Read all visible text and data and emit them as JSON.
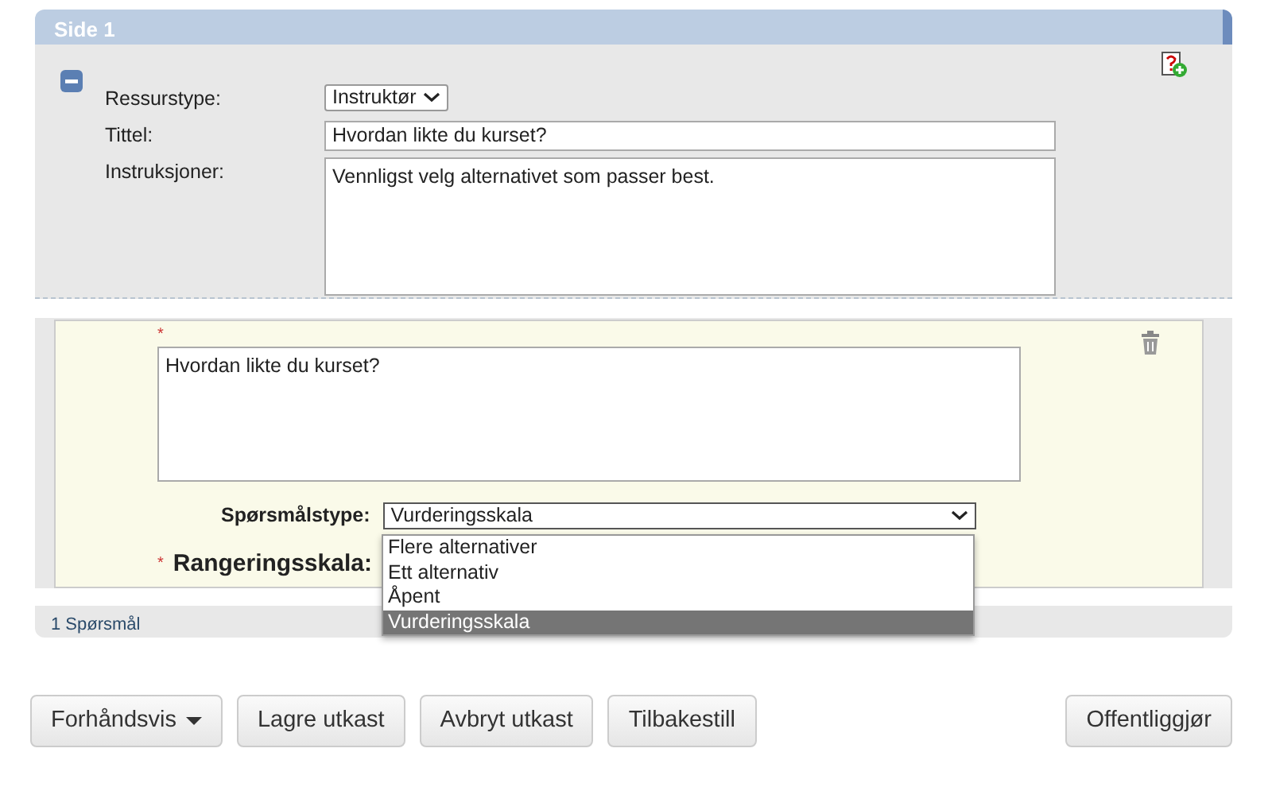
{
  "page": {
    "title": "Side 1",
    "fields": [
      {
        "label": "Ressurstype:",
        "kind": "select",
        "value": "Instruktør"
      },
      {
        "label": "Tittel:",
        "kind": "text",
        "value": "Hvordan likte du kurset?"
      },
      {
        "label": "Instruksjoner:",
        "kind": "textarea",
        "value": "Vennligst velg alternativet som passer best."
      }
    ]
  },
  "question": {
    "required_mark": "*",
    "text": "Hvordan likte du kurset?",
    "type_label": "Spørsmålstype:",
    "type_value": "Vurderingsskala",
    "expanded": true,
    "options": [
      {
        "label": "Flere alternativer",
        "selected": false
      },
      {
        "label": "Ett alternativ",
        "selected": false
      },
      {
        "label": "Åpent",
        "selected": false
      },
      {
        "label": "Vurderingsskala",
        "selected": true
      }
    ],
    "scale_required_mark": "*",
    "scale_label": "Rangeringsskala:"
  },
  "footer": "1 Spørsmål",
  "buttons": [
    {
      "label": "Forhåndsvis",
      "kind": "dropdown"
    },
    {
      "label": "Lagre utkast",
      "kind": "plain"
    },
    {
      "label": "Avbryt utkast",
      "kind": "plain"
    },
    {
      "label": "Tilbakestill",
      "kind": "plain"
    },
    {
      "label": "Offentliggjør",
      "kind": "right"
    }
  ]
}
